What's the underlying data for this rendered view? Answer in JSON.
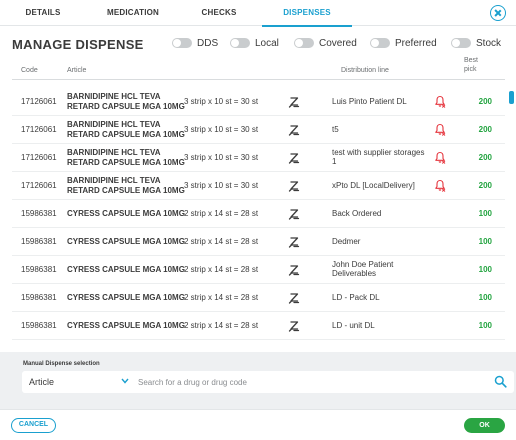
{
  "tabs": [
    {
      "label": "DETAILS"
    },
    {
      "label": "MEDICATION"
    },
    {
      "label": "CHECKS"
    },
    {
      "label": "DISPENSES",
      "active": true
    }
  ],
  "title": "MANAGE DISPENSE",
  "filters": [
    {
      "label": "DDS",
      "on": false
    },
    {
      "label": "Local",
      "on": false
    },
    {
      "label": "Covered",
      "on": false
    },
    {
      "label": "Preferred",
      "on": false
    },
    {
      "label": "Stock",
      "on": false
    }
  ],
  "columns": {
    "code": "Code",
    "article": "Article",
    "distribution": "Distribution line",
    "best_pick": "Best pick"
  },
  "rows": [
    {
      "code": "17126061",
      "article": [
        "BARNIDIPINE HCL TEVA",
        "RETARD CAPSULE MGA 10MG"
      ],
      "qty": "3 strip x 10 st = 30 st",
      "dist": [
        "Luis Pinto Patient DL"
      ],
      "bell": true,
      "best": "200"
    },
    {
      "code": "17126061",
      "article": [
        "BARNIDIPINE HCL TEVA",
        "RETARD CAPSULE MGA 10MG"
      ],
      "qty": "3 strip x 10 st = 30 st",
      "dist": [
        "t5"
      ],
      "bell": true,
      "best": "200"
    },
    {
      "code": "17126061",
      "article": [
        "BARNIDIPINE HCL TEVA",
        "RETARD CAPSULE MGA 10MG"
      ],
      "qty": "3 strip x 10 st = 30 st",
      "dist": [
        "test with supplier storages",
        "1"
      ],
      "bell": true,
      "best": "200"
    },
    {
      "code": "17126061",
      "article": [
        "BARNIDIPINE HCL TEVA",
        "RETARD CAPSULE MGA 10MG"
      ],
      "qty": "3 strip x 10 st = 30 st",
      "dist": [
        "xPto DL [LocalDelivery]"
      ],
      "bell": true,
      "best": "200"
    },
    {
      "code": "15986381",
      "article": [
        "CYRESS CAPSULE MGA 10MG"
      ],
      "qty": "2 strip x 14 st = 28 st",
      "dist": [
        "Back Ordered"
      ],
      "bell": false,
      "best": "100"
    },
    {
      "code": "15986381",
      "article": [
        "CYRESS CAPSULE MGA 10MG"
      ],
      "qty": "2 strip x 14 st = 28 st",
      "dist": [
        "Dedmer"
      ],
      "bell": false,
      "best": "100"
    },
    {
      "code": "15986381",
      "article": [
        "CYRESS CAPSULE MGA 10MG"
      ],
      "qty": "2 strip x 14 st = 28 st",
      "dist": [
        "John Doe Patient",
        "Deliverables"
      ],
      "bell": false,
      "best": "100"
    },
    {
      "code": "15986381",
      "article": [
        "CYRESS CAPSULE MGA 10MG"
      ],
      "qty": "2 strip x 14 st = 28 st",
      "dist": [
        "LD - Pack DL"
      ],
      "bell": false,
      "best": "100"
    },
    {
      "code": "15986381",
      "article": [
        "CYRESS CAPSULE MGA 10MG"
      ],
      "qty": "2 strip x 14 st = 28 st",
      "dist": [
        "LD - unit DL"
      ],
      "bell": false,
      "best": "100"
    }
  ],
  "manual": {
    "label": "Manual Dispense selection",
    "select_value": "Article",
    "search_placeholder": "Search for a drug or drug code"
  },
  "buttons": {
    "cancel": "CANCEL",
    "ok": "OK"
  },
  "colors": {
    "accent": "#1aa0cf",
    "success": "#23a440",
    "alert": "#e5343d"
  }
}
